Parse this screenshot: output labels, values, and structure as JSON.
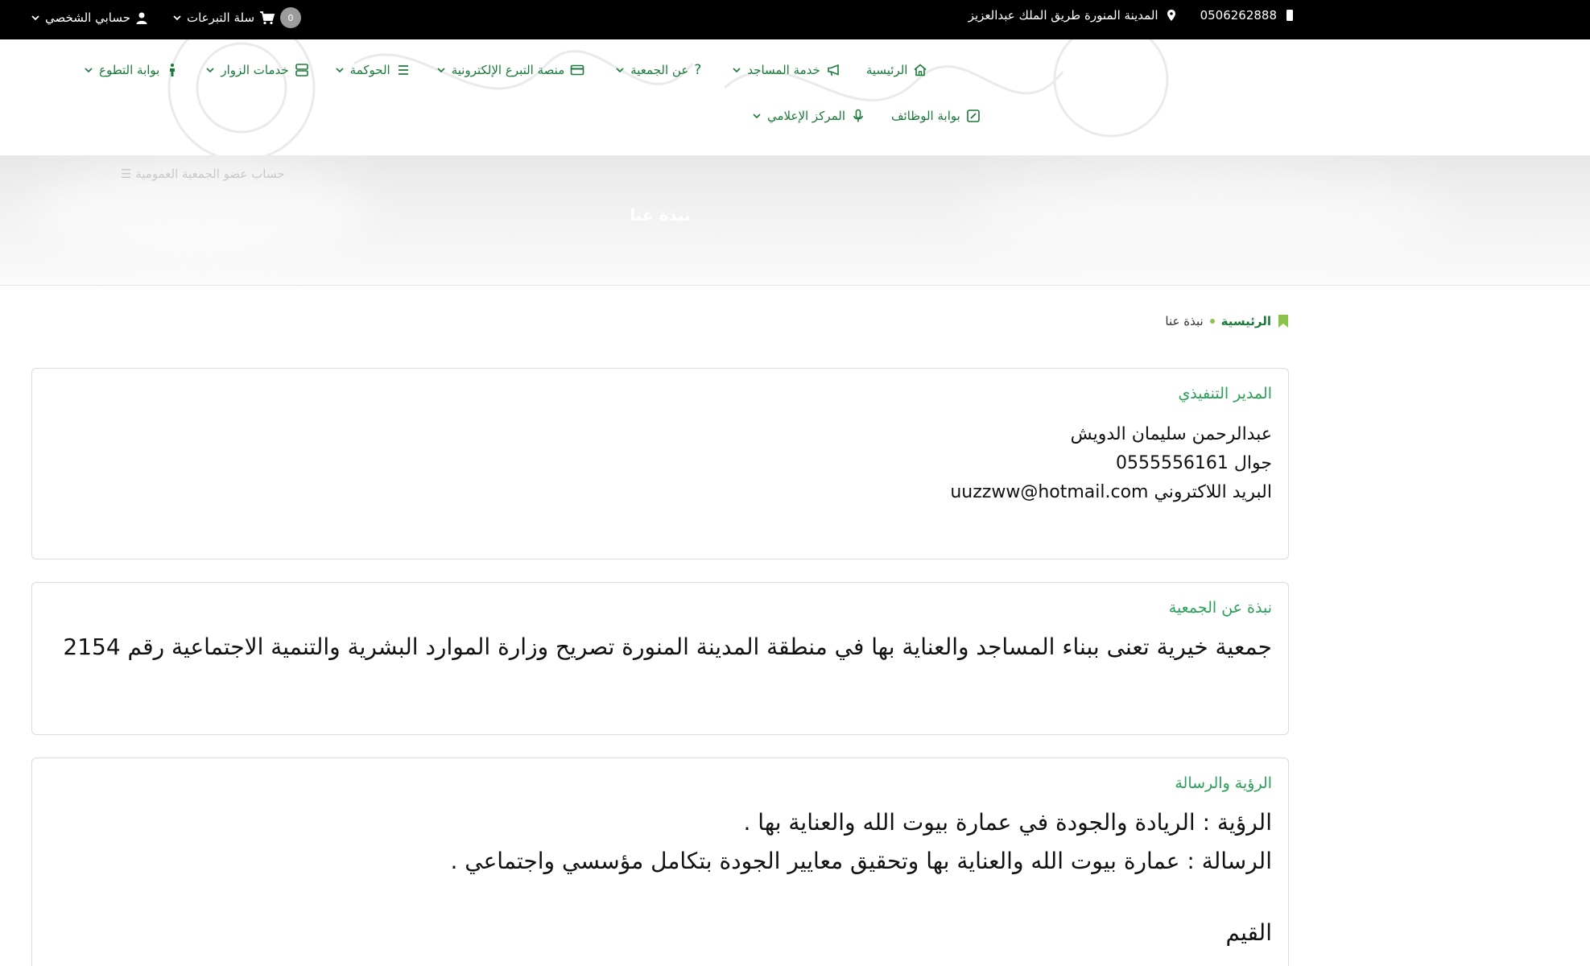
{
  "topbar": {
    "phone": "0506262888",
    "address": "المدينة المنورة طريق الملك عبدالعزيز",
    "cart_label": "سلة التبرعات",
    "cart_count": "0",
    "account_label": "حسابي الشخصي"
  },
  "nav": {
    "row1": [
      {
        "label": "الرئيسية",
        "icon": "home-icon",
        "dropdown": false
      },
      {
        "label": "خدمة المساجد",
        "icon": "megaphone-icon",
        "dropdown": true
      },
      {
        "label": "عن الجمعية",
        "icon": "question-icon",
        "dropdown": true
      },
      {
        "label": "منصة التبرع الإلكترونية",
        "icon": "credit-card-icon",
        "dropdown": true
      },
      {
        "label": "الحوكمة",
        "icon": "list-icon",
        "dropdown": true
      },
      {
        "label": "خدمات الزوار",
        "icon": "server-icon",
        "dropdown": true
      },
      {
        "label": "بوابة التطوع",
        "icon": "person-icon",
        "dropdown": true
      }
    ],
    "row2": [
      {
        "label": "بوابة الوظائف",
        "icon": "edit-square-icon",
        "dropdown": false
      },
      {
        "label": "المركز الإعلامي",
        "icon": "microphone-icon",
        "dropdown": true
      }
    ]
  },
  "banner": {
    "title": "نبذة عنا",
    "faded_link": "حساب عضو الجمعية العمومية"
  },
  "breadcrumb": {
    "home": "الرئيسية",
    "current": "نبذة عنا"
  },
  "cards": {
    "executive": {
      "title": "المدير التنفيذي",
      "name": "عبدالرحمن سليمان الدويش",
      "mobile": "جوال 0555556161",
      "email": "البريد اللاكتروني uuzzww@hotmail.com"
    },
    "about": {
      "title": "نبذة عن الجمعية",
      "text": "جمعية خيرية تعنى ببناء المساجد والعناية بها في منطقة المدينة المنورة تصريح وزارة الموارد البشرية والتنمية الاجتماعية رقم 2154"
    },
    "vision": {
      "title": "الرؤية والرسالة",
      "vision": "الرؤية : الريادة  والجودة في عمارة بيوت الله والعناية بها .",
      "mission": "الرسالة : عمارة بيوت الله والعناية بها وتحقيق معايير الجودة  بتكامل مؤسسي  واجتماعي .",
      "partial": "القيم"
    }
  },
  "colors": {
    "accent_green": "#1a7a3a",
    "heading_green": "#2aa058",
    "topbar_bg": "#000000"
  }
}
